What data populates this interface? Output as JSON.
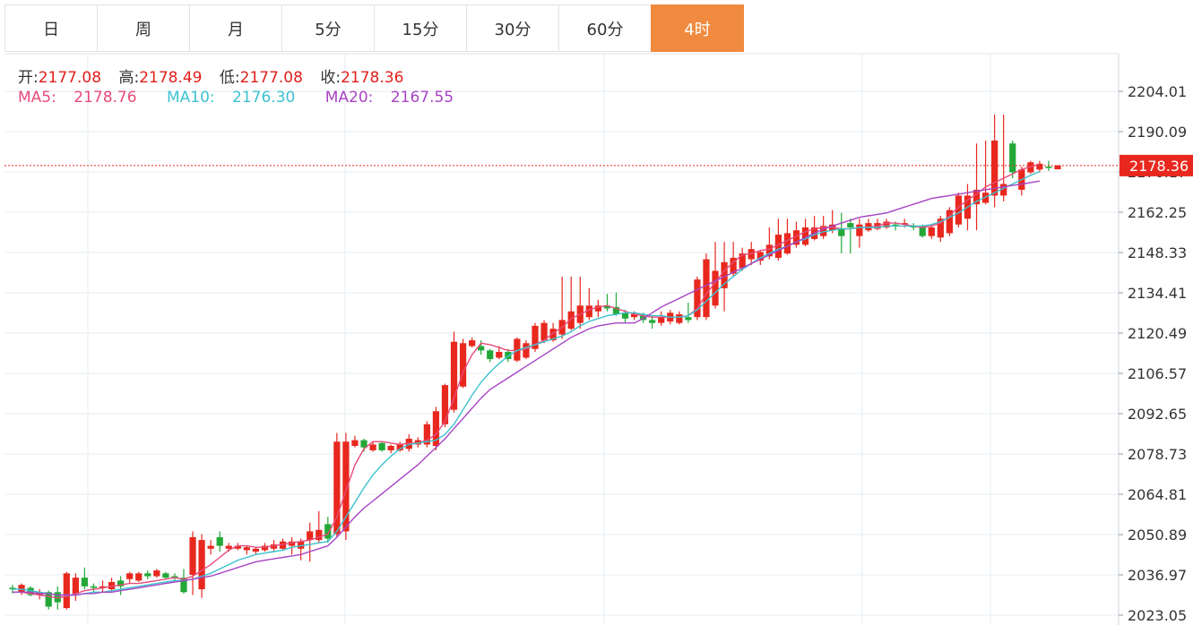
{
  "tabs": [
    "日",
    "周",
    "月",
    "5分",
    "15分",
    "30分",
    "60分",
    "4时"
  ],
  "active_tab": 7,
  "ohlc": {
    "open_label": "开:",
    "open": "2177.08",
    "high_label": "高:",
    "high": "2178.49",
    "low_label": "低:",
    "low": "2177.08",
    "close_label": "收:",
    "close": "2178.36"
  },
  "ma": {
    "ma5_label": "MA5:",
    "ma5": "2178.76",
    "ma10_label": "MA10:",
    "ma10": "2176.30",
    "ma20_label": "MA20:",
    "ma20": "2167.55"
  },
  "colors": {
    "up": "#e8281e",
    "down": "#23a838",
    "ma5": "#e74b7a",
    "ma10": "#3cc2cf",
    "ma20": "#a844c4",
    "grid": "#e6edf3",
    "active_tab": "#f08a3e"
  },
  "chart_data": {
    "type": "candlestick",
    "ylim": [
      2023.05,
      2210
    ],
    "y_ticks": [
      "2204.01",
      "2190.09",
      "2176.17",
      "2162.25",
      "2148.33",
      "2134.41",
      "2120.49",
      "2106.57",
      "2092.65",
      "2078.73",
      "2064.81",
      "2050.89",
      "2036.97",
      "2023.05"
    ],
    "last_price": "2178.36",
    "candles": [
      [
        2032.5,
        2032.0,
        2033.5,
        2030.5
      ],
      [
        2031.0,
        2033.5,
        2034.0,
        2030.0
      ],
      [
        2032.5,
        2030.0,
        2033.0,
        2029.5
      ],
      [
        2030.0,
        2031.0,
        2032.0,
        2028.5
      ],
      [
        2031.0,
        2026.0,
        2031.5,
        2025.0
      ],
      [
        2031.0,
        2027.5,
        2033.0,
        2025.0
      ],
      [
        2025.5,
        2037.5,
        2038.0,
        2025.0
      ],
      [
        2030.5,
        2036.0,
        2037.5,
        2028.0
      ],
      [
        2036.0,
        2033.0,
        2039.5,
        2032.0
      ],
      [
        2033.0,
        2032.5,
        2034.0,
        2031.0
      ],
      [
        2032.5,
        2033.0,
        2035.0,
        2031.0
      ],
      [
        2032.0,
        2034.5,
        2036.0,
        2031.5
      ],
      [
        2035.0,
        2033.0,
        2036.5,
        2030.0
      ],
      [
        2035.5,
        2037.5,
        2038.0,
        2034.0
      ],
      [
        2035.0,
        2037.5,
        2038.0,
        2034.5
      ],
      [
        2037.5,
        2036.5,
        2038.5,
        2035.5
      ],
      [
        2036.5,
        2038.5,
        2039.0,
        2036.0
      ],
      [
        2037.5,
        2036.0,
        2038.0,
        2035.5
      ],
      [
        2036.5,
        2036.0,
        2037.5,
        2035.0
      ],
      [
        2036.0,
        2031.0,
        2039.0,
        2030.5
      ],
      [
        2037.0,
        2050.0,
        2052.0,
        2030.0
      ],
      [
        2032.0,
        2049.0,
        2051.0,
        2029.0
      ],
      [
        2046.0,
        2047.0,
        2049.0,
        2044.0
      ],
      [
        2050.0,
        2047.0,
        2052.0,
        2045.0
      ],
      [
        2046.0,
        2047.0,
        2048.0,
        2045.0
      ],
      [
        2046.0,
        2047.0,
        2048.0,
        2045.5
      ],
      [
        2045.5,
        2046.5,
        2047.0,
        2044.0
      ],
      [
        2045.0,
        2046.0,
        2046.5,
        2044.0
      ],
      [
        2045.5,
        2047.0,
        2048.0,
        2045.0
      ],
      [
        2046.0,
        2047.5,
        2049.0,
        2045.0
      ],
      [
        2046.0,
        2048.5,
        2049.5,
        2045.5
      ],
      [
        2047.0,
        2048.5,
        2050.0,
        2044.0
      ],
      [
        2046.0,
        2048.5,
        2049.5,
        2042.0
      ],
      [
        2049.0,
        2052.0,
        2055.0,
        2041.5
      ],
      [
        2049.0,
        2052.5,
        2059.0,
        2048.0
      ],
      [
        2054.5,
        2049.5,
        2057.0,
        2048.0
      ],
      [
        2051.0,
        2083.0,
        2086.0,
        2050.0
      ],
      [
        2052.0,
        2083.0,
        2086.0,
        2049.0
      ],
      [
        2081.5,
        2083.5,
        2085.0,
        2081.0
      ],
      [
        2083.5,
        2081.0,
        2084.0,
        2079.5
      ],
      [
        2080.0,
        2082.0,
        2083.0,
        2079.5
      ],
      [
        2082.5,
        2080.0,
        2083.0,
        2079.5
      ],
      [
        2080.0,
        2081.5,
        2082.0,
        2079.0
      ],
      [
        2080.0,
        2082.0,
        2083.0,
        2079.5
      ],
      [
        2080.5,
        2084.0,
        2085.5,
        2079.5
      ],
      [
        2082.0,
        2083.5,
        2084.5,
        2081.0
      ],
      [
        2082.0,
        2089.0,
        2090.0,
        2081.0
      ],
      [
        2081.5,
        2093.5,
        2095.0,
        2080.0
      ],
      [
        2089.0,
        2102.5,
        2103.0,
        2088.0
      ],
      [
        2094.0,
        2117.5,
        2121.0,
        2093.0
      ],
      [
        2102.0,
        2117.0,
        2118.5,
        2101.5
      ],
      [
        2116.0,
        2118.0,
        2119.0,
        2115.5
      ],
      [
        2116.0,
        2114.5,
        2118.0,
        2113.0
      ],
      [
        2114.5,
        2111.5,
        2115.0,
        2110.5
      ],
      [
        2112.0,
        2114.0,
        2116.0,
        2111.5
      ],
      [
        2114.0,
        2111.5,
        2115.0,
        2110.5
      ],
      [
        2111.0,
        2118.5,
        2119.0,
        2110.5
      ],
      [
        2112.0,
        2117.0,
        2118.0,
        2111.5
      ],
      [
        2115.0,
        2123.0,
        2124.0,
        2114.0
      ],
      [
        2118.0,
        2124.0,
        2125.0,
        2117.0
      ],
      [
        2118.0,
        2122.0,
        2124.0,
        2117.5
      ],
      [
        2120.0,
        2125.0,
        2140.0,
        2118.5
      ],
      [
        2122.0,
        2128.0,
        2140.0,
        2121.5
      ],
      [
        2124.0,
        2130.0,
        2140.0,
        2122.0
      ],
      [
        2126.0,
        2130.0,
        2136.0,
        2125.0
      ],
      [
        2128.0,
        2130.0,
        2132.0,
        2126.0
      ],
      [
        2130.0,
        2129.0,
        2134.0,
        2128.0
      ],
      [
        2129.5,
        2127.0,
        2134.5,
        2126.5
      ],
      [
        2127.5,
        2125.5,
        2128.5,
        2124.0
      ],
      [
        2126.0,
        2127.0,
        2128.0,
        2125.0
      ],
      [
        2126.5,
        2125.0,
        2127.5,
        2124.0
      ],
      [
        2125.0,
        2124.0,
        2126.5,
        2122.0
      ],
      [
        2124.0,
        2126.0,
        2128.0,
        2123.0
      ],
      [
        2124.5,
        2127.5,
        2128.5,
        2123.5
      ],
      [
        2124.0,
        2127.0,
        2128.0,
        2123.5
      ],
      [
        2126.0,
        2125.0,
        2131.0,
        2124.0
      ],
      [
        2126.0,
        2139.0,
        2140.0,
        2125.0
      ],
      [
        2126.0,
        2146.0,
        2148.0,
        2125.0
      ],
      [
        2130.0,
        2142.0,
        2152.0,
        2129.0
      ],
      [
        2136.0,
        2145.0,
        2152.0,
        2128.0
      ],
      [
        2141.0,
        2146.5,
        2152.0,
        2140.0
      ],
      [
        2143.0,
        2148.0,
        2150.0,
        2142.0
      ],
      [
        2146.0,
        2149.5,
        2152.0,
        2144.0
      ],
      [
        2145.5,
        2148.5,
        2149.0,
        2144.0
      ],
      [
        2147.0,
        2151.0,
        2157.0,
        2146.0
      ],
      [
        2146.5,
        2154.5,
        2160.0,
        2145.5
      ],
      [
        2148.0,
        2155.0,
        2160.0,
        2147.5
      ],
      [
        2151.0,
        2156.0,
        2159.0,
        2150.0
      ],
      [
        2151.0,
        2157.0,
        2160.0,
        2150.5
      ],
      [
        2153.0,
        2157.0,
        2161.0,
        2152.5
      ],
      [
        2154.0,
        2157.5,
        2161.0,
        2153.0
      ],
      [
        2156.0,
        2158.0,
        2163.0,
        2155.0
      ],
      [
        2156.5,
        2154.0,
        2162.0,
        2148.0
      ],
      [
        2158.5,
        2157.0,
        2160.0,
        2148.0
      ],
      [
        2154.0,
        2158.0,
        2160.0,
        2150.0
      ],
      [
        2156.0,
        2158.5,
        2160.0,
        2155.5
      ],
      [
        2156.5,
        2158.5,
        2160.0,
        2156.0
      ],
      [
        2157.0,
        2159.0,
        2160.0,
        2156.5
      ],
      [
        2158.0,
        2157.5,
        2159.0,
        2156.0
      ],
      [
        2158.0,
        2158.5,
        2160.0,
        2157.0
      ],
      [
        2157.5,
        2157.0,
        2158.5,
        2156.0
      ],
      [
        2157.5,
        2154.0,
        2158.0,
        2153.5
      ],
      [
        2154.0,
        2157.0,
        2158.0,
        2153.0
      ],
      [
        2153.5,
        2160.0,
        2161.0,
        2152.0
      ],
      [
        2155.0,
        2163.0,
        2164.0,
        2154.0
      ],
      [
        2158.0,
        2168.0,
        2169.0,
        2157.0
      ],
      [
        2160.0,
        2168.0,
        2172.0,
        2156.0
      ],
      [
        2165.0,
        2170.0,
        2186.0,
        2156.0
      ],
      [
        2165.5,
        2169.0,
        2187.0,
        2165.0
      ],
      [
        2168.0,
        2187.0,
        2196.0,
        2164.0
      ],
      [
        2168.0,
        2172.0,
        2196.0,
        2166.0
      ],
      [
        2186.0,
        2176.0,
        2187.0,
        2174.0
      ],
      [
        2170.0,
        2177.0,
        2178.0,
        2168.0
      ],
      [
        2176.0,
        2179.5,
        2180.0,
        2175.5
      ],
      [
        2177.0,
        2179.0,
        2180.0,
        2176.0
      ],
      [
        2178.0,
        2177.5,
        2180.0,
        2176.5
      ],
      [
        2177.08,
        2178.36,
        2178.49,
        2177.08
      ]
    ],
    "ma5": [
      2031.0,
      2031.0,
      2030.5,
      2030.0,
      2029.5,
      2029.0,
      2029.5,
      2030.5,
      2031.5,
      2032.0,
      2032.5,
      2033.0,
      2033.5,
      2034.0,
      2034.0,
      2034.5,
      2035.0,
      2035.5,
      2036.0,
      2035.5,
      2036.5,
      2038.5,
      2040.5,
      2043.0,
      2045.5,
      2047.0,
      2047.0,
      2046.5,
      2046.5,
      2047.0,
      2047.5,
      2048.0,
      2048.5,
      2049.0,
      2050.0,
      2051.0,
      2057.0,
      2066.0,
      2075.0,
      2080.5,
      2083.0,
      2083.0,
      2082.5,
      2082.0,
      2082.5,
      2082.5,
      2083.5,
      2085.5,
      2090.0,
      2098.0,
      2107.0,
      2113.0,
      2117.0,
      2116.5,
      2115.5,
      2114.5,
      2114.5,
      2115.0,
      2116.5,
      2118.0,
      2120.5,
      2122.5,
      2125.5,
      2127.0,
      2128.5,
      2129.5,
      2130.0,
      2129.0,
      2128.0,
      2127.0,
      2126.5,
      2126.0,
      2126.0,
      2126.0,
      2126.0,
      2126.5,
      2129.0,
      2134.0,
      2138.0,
      2142.0,
      2145.0,
      2147.5,
      2148.0,
      2149.0,
      2149.5,
      2151.0,
      2152.5,
      2154.0,
      2155.5,
      2156.5,
      2157.0,
      2157.0,
      2156.5,
      2156.5,
      2157.0,
      2157.0,
      2157.5,
      2158.5,
      2158.5,
      2158.0,
      2157.5,
      2157.0,
      2157.5,
      2158.5,
      2161.0,
      2164.0,
      2166.5,
      2168.5,
      2171.0,
      2172.5,
      2174.0,
      2175.5,
      2177.0,
      2178.0,
      2178.76
    ],
    "ma10": [
      2032.0,
      2032.0,
      2031.5,
      2031.0,
      2030.5,
      2030.0,
      2030.0,
      2030.0,
      2030.5,
      2031.0,
      2031.0,
      2031.5,
      2032.0,
      2032.5,
      2033.0,
      2033.5,
      2034.0,
      2034.5,
      2035.0,
      2035.0,
      2035.5,
      2036.5,
      2037.5,
      2039.0,
      2040.5,
      2042.0,
      2043.0,
      2044.0,
      2044.5,
      2045.0,
      2045.5,
      2046.5,
      2047.0,
      2047.5,
      2048.0,
      2048.5,
      2052.0,
      2057.0,
      2062.0,
      2067.0,
      2071.5,
      2075.0,
      2078.0,
      2080.5,
      2082.0,
      2082.5,
      2083.0,
      2083.5,
      2085.5,
      2089.0,
      2094.0,
      2099.0,
      2103.5,
      2107.0,
      2110.0,
      2112.5,
      2114.5,
      2115.5,
      2116.5,
      2117.5,
      2118.5,
      2119.5,
      2121.0,
      2123.0,
      2124.5,
      2125.5,
      2126.5,
      2127.0,
      2127.5,
      2127.5,
      2127.0,
      2126.5,
      2126.5,
      2126.0,
      2126.0,
      2126.5,
      2128.5,
      2131.5,
      2134.5,
      2137.5,
      2140.0,
      2142.5,
      2144.5,
      2146.5,
      2148.0,
      2149.5,
      2150.5,
      2152.0,
      2153.0,
      2154.5,
      2155.5,
      2156.0,
      2156.5,
      2156.5,
      2157.0,
      2157.0,
      2157.0,
      2157.5,
      2157.5,
      2157.5,
      2157.5,
      2157.5,
      2158.0,
      2159.0,
      2160.5,
      2162.0,
      2164.0,
      2166.0,
      2167.5,
      2169.0,
      2170.5,
      2172.0,
      2173.5,
      2175.0,
      2176.3
    ],
    "ma20": [
      2031.0,
      2031.0,
      2031.0,
      2030.5,
      2030.5,
      2030.0,
      2030.0,
      2030.0,
      2030.5,
      2030.5,
      2031.0,
      2031.0,
      2031.5,
      2032.0,
      2032.5,
      2033.0,
      2033.5,
      2034.0,
      2034.5,
      2035.0,
      2035.5,
      2036.0,
      2036.5,
      2037.5,
      2038.5,
      2039.5,
      2040.5,
      2041.5,
      2042.0,
      2042.5,
      2043.0,
      2043.5,
      2044.0,
      2045.0,
      2046.0,
      2047.0,
      2050.0,
      2053.5,
      2057.0,
      2060.0,
      2062.5,
      2065.0,
      2067.5,
      2070.0,
      2072.5,
      2075.0,
      2078.0,
      2081.0,
      2084.0,
      2087.5,
      2091.0,
      2094.5,
      2098.0,
      2101.0,
      2103.0,
      2105.0,
      2107.0,
      2109.0,
      2111.0,
      2113.0,
      2115.0,
      2117.0,
      2119.0,
      2120.5,
      2122.0,
      2123.0,
      2123.5,
      2124.0,
      2124.0,
      2124.0,
      2125.5,
      2127.5,
      2129.5,
      2131.0,
      2132.5,
      2134.0,
      2135.5,
      2137.0,
      2138.5,
      2140.0,
      2141.5,
      2143.0,
      2144.5,
      2146.0,
      2147.5,
      2149.0,
      2150.5,
      2152.0,
      2153.5,
      2155.0,
      2156.5,
      2157.5,
      2158.5,
      2159.5,
      2160.5,
      2161.0,
      2161.5,
      2162.0,
      2163.0,
      2164.0,
      2165.0,
      2166.0,
      2167.0,
      2167.5,
      2168.0,
      2168.5,
      2169.0,
      2169.5,
      2170.0,
      2170.5,
      2171.0,
      2171.5,
      2172.0,
      2172.5,
      2173.0
    ]
  }
}
